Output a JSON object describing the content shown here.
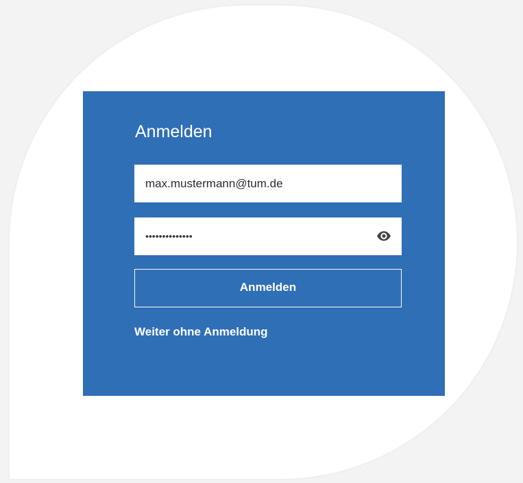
{
  "login": {
    "title": "Anmelden",
    "email_value": "max.mustermann@tum.de",
    "password_mask": "••••••••••••••",
    "submit_label": "Anmelden",
    "guest_link": "Weiter ohne Anmeldung",
    "show_password_icon": "eye-icon"
  },
  "colors": {
    "panel_background": "#2f6fb5",
    "text": "#ffffff",
    "field_background": "#ffffff"
  }
}
